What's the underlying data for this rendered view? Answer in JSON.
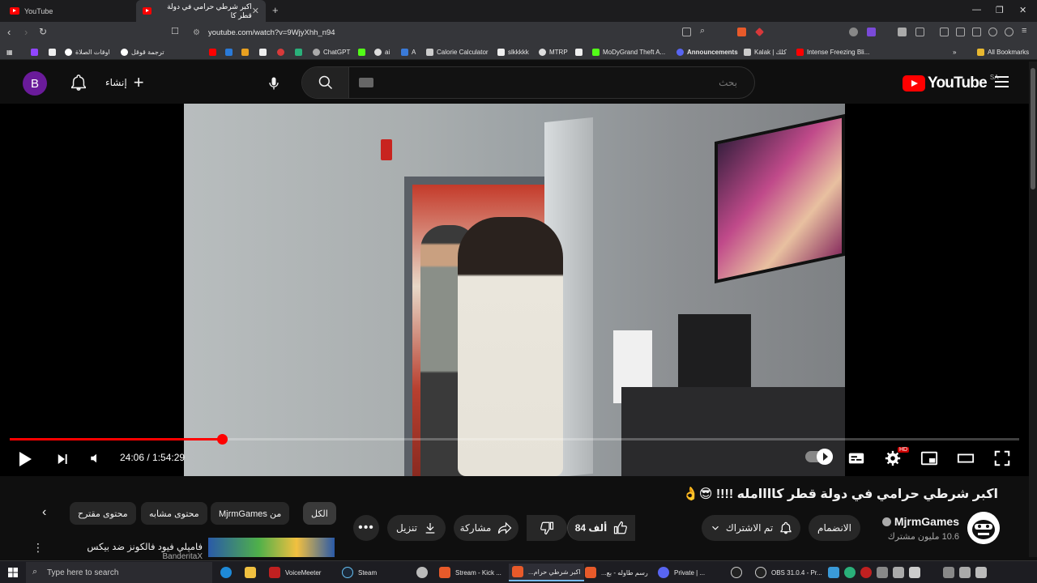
{
  "browser": {
    "tabs": [
      {
        "title": "YouTube",
        "active": false
      },
      {
        "title": "اكبر شرطي حرامي في دولة قطر كا",
        "active": true
      }
    ],
    "url": "youtube.com/watch?v=9WjyXhh_n94",
    "bookmarks": [
      "اوقات الصلاة",
      "ترجمة قوقل",
      "ChatGPT",
      "ai",
      "A",
      "Calorie Calculator",
      "slkkkkk",
      "MTRP",
      "MoDyGrand Theft A...",
      "Announcements",
      "Kalak | كلك",
      "Intense Freezing Bli..."
    ],
    "all_bookmarks": "All Bookmarks"
  },
  "header": {
    "avatar_letter": "B",
    "create_label": "إنشاء",
    "search_placeholder": "بحث",
    "logo_text": "YouTube",
    "country_code": "SA"
  },
  "player": {
    "time_current": "24:06",
    "time_total": "1:54:29",
    "time_display": "24:06 / 1:54:29",
    "progress_fraction": 0.21,
    "hd_badge": "HD"
  },
  "video": {
    "title": "اكبر شرطي حرامي في دولة قطر كاااامله !!!! 😎👌",
    "channel_name": "MjrmGames",
    "subscribers": "10.6 مليون مشترك",
    "join_label": "الانضمام",
    "subscribed_label": "تم الاشتراك",
    "likes": "84 ألف",
    "share_label": "مشاركة",
    "download_label": "تنزيل"
  },
  "chips": {
    "all": "الكل",
    "from_channel": "من MjrmGames",
    "related": "محتوى مشابه",
    "suggested": "محتوى مقترح"
  },
  "recommendation": {
    "title": "فاميلي فيود فالكونز ضد بيكس",
    "channel": "BanderitaX"
  },
  "taskbar": {
    "search_placeholder": "Type here to search",
    "items": [
      "VoiceMeeter",
      "Steam",
      "Stream - Kick ...",
      "اكبر شرطي حرام...",
      "رسم طاوله - بع...",
      "Private | ...",
      "OBS 31.0.4 - Pr..."
    ]
  },
  "colors": {
    "accent": "#ff0000",
    "background": "#0f0f0f",
    "chip": "#272727"
  }
}
